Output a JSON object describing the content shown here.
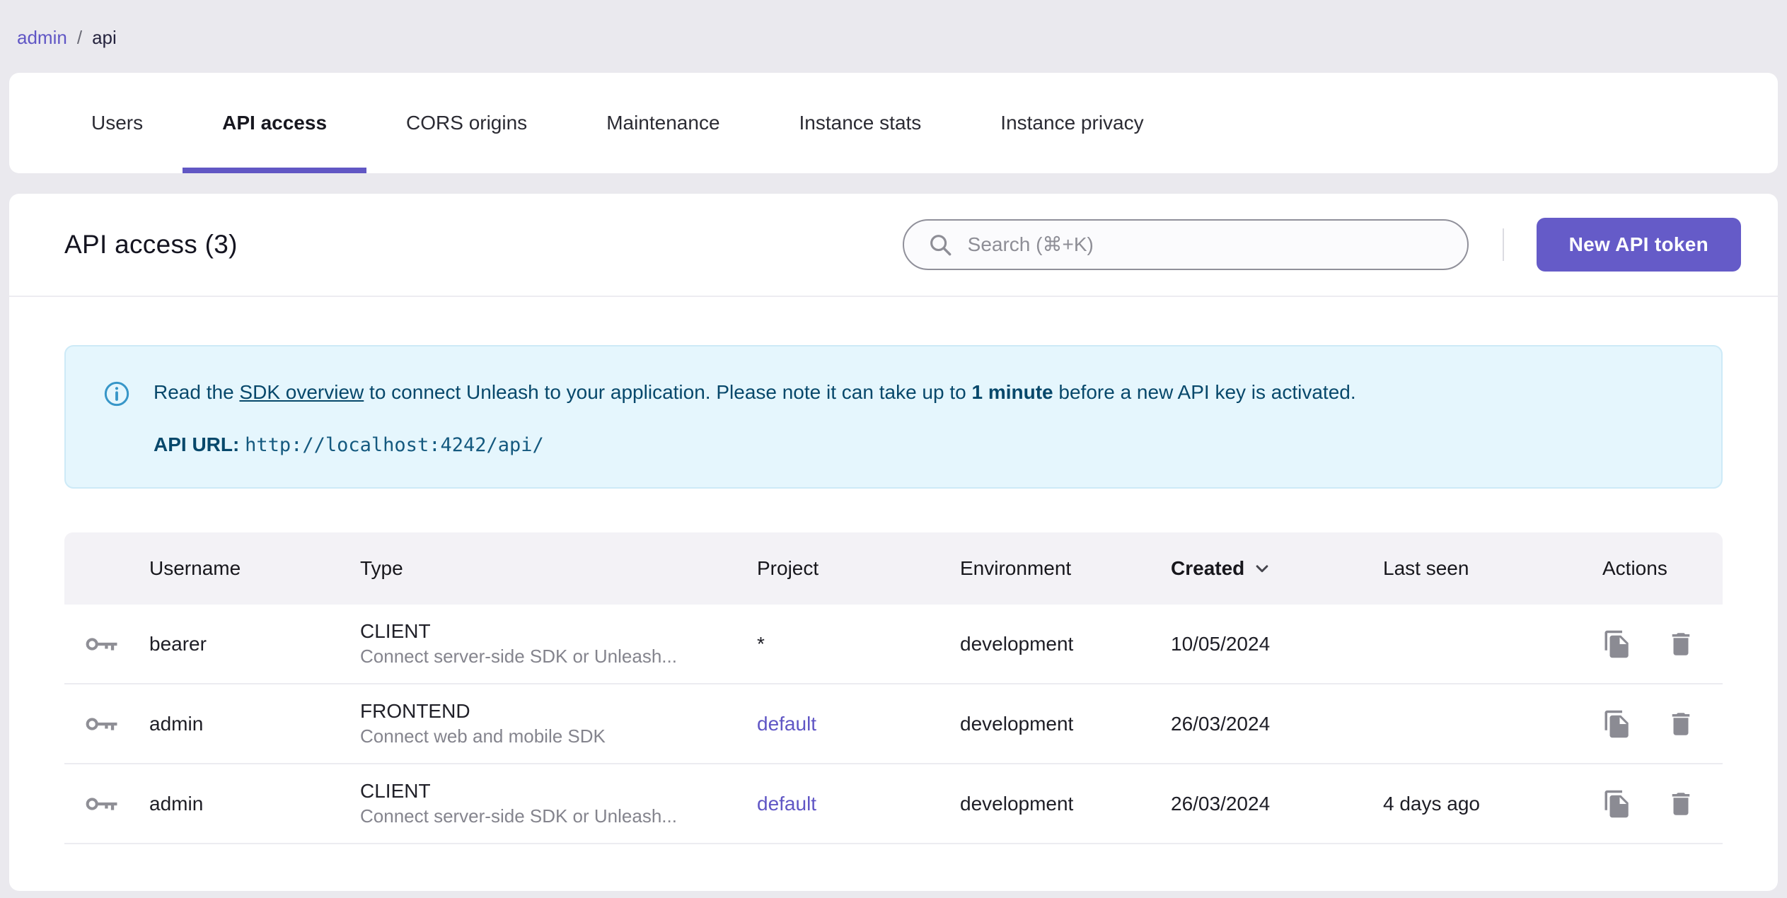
{
  "breadcrumb": {
    "admin": "admin",
    "separator": "/",
    "current": "api"
  },
  "tabs": {
    "items": [
      {
        "label": "Users"
      },
      {
        "label": "API access"
      },
      {
        "label": "CORS origins"
      },
      {
        "label": "Maintenance"
      },
      {
        "label": "Instance stats"
      },
      {
        "label": "Instance privacy"
      }
    ],
    "active": "API access"
  },
  "header": {
    "title": "API access (3)",
    "search_placeholder": "Search (⌘+K)",
    "new_token_label": "New API token"
  },
  "alert": {
    "text1": "Read the ",
    "link": "SDK overview",
    "text2": " to connect Unleash to your application. Please note it can take up to ",
    "bold": "1 minute",
    "text3": " before a new API key is activated.",
    "api_url_label": "API URL:",
    "api_url": "http://localhost:4242/api/"
  },
  "table": {
    "headers": {
      "username": "Username",
      "type": "Type",
      "project": "Project",
      "environment": "Environment",
      "created": "Created",
      "last_seen": "Last seen",
      "actions": "Actions"
    },
    "sort": {
      "column": "Created",
      "direction": "desc"
    },
    "rows": [
      {
        "username": "bearer",
        "type": "CLIENT",
        "type_desc": "Connect server-side SDK or Unleash...",
        "project": "*",
        "environment": "development",
        "created": "10/05/2024",
        "last_seen": ""
      },
      {
        "username": "admin",
        "type": "FRONTEND",
        "type_desc": "Connect web and mobile SDK",
        "project": "default",
        "environment": "development",
        "created": "26/03/2024",
        "last_seen": ""
      },
      {
        "username": "admin",
        "type": "CLIENT",
        "type_desc": "Connect server-side SDK or Unleash...",
        "project": "default",
        "environment": "development",
        "created": "26/03/2024",
        "last_seen": "4 days ago"
      }
    ]
  },
  "icons": {
    "search": "magnifier",
    "info": "info-circle",
    "sort": "chevron-down",
    "token": "key",
    "copy": "copy-document",
    "delete": "trash"
  },
  "colors": {
    "accent": "#655bc8",
    "tab_indicator": "#6157c4",
    "link": "#6056c5",
    "alert_bg": "#e5f6fd",
    "alert_text": "#07486b",
    "table_header_bg": "#f3f2f6",
    "page_bg": "#eae9ee"
  }
}
